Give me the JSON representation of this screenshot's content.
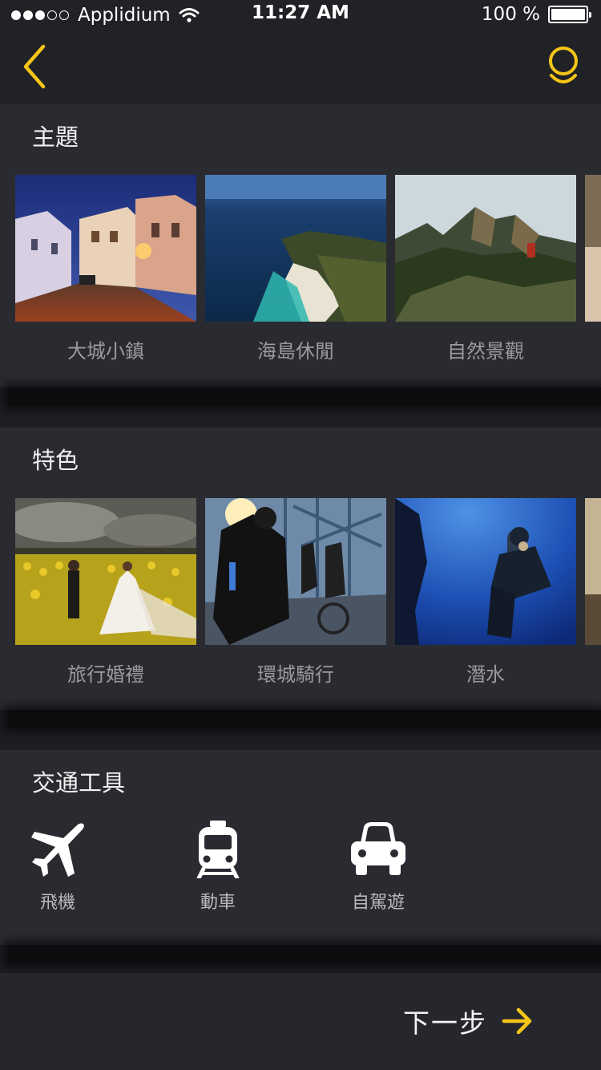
{
  "status_bar": {
    "carrier": "Applidium",
    "time": "11:27 AM",
    "battery": "100 %",
    "signal_dots_filled": 3,
    "signal_dots_total": 5
  },
  "nav": {
    "back_icon": "chevron-left-icon",
    "profile_icon": "profile-icon",
    "accent_color": "#f5c518"
  },
  "sections": {
    "theme": {
      "title": "主題",
      "items": [
        {
          "label": "大城小鎮",
          "image": "town-street-at-dusk"
        },
        {
          "label": "海島休閒",
          "image": "coastal-cliffs"
        },
        {
          "label": "自然景觀",
          "image": "mountain-peaks"
        }
      ]
    },
    "feature": {
      "title": "特色",
      "items": [
        {
          "label": "旅行婚禮",
          "image": "sunflower-wedding"
        },
        {
          "label": "環城騎行",
          "image": "cyclists-on-bridge"
        },
        {
          "label": "潛水",
          "image": "scuba-diver"
        }
      ]
    },
    "transport": {
      "title": "交通工具",
      "items": [
        {
          "label": "飛機",
          "icon": "airplane-icon"
        },
        {
          "label": "動車",
          "icon": "train-icon"
        },
        {
          "label": "自駕遊",
          "icon": "car-icon"
        }
      ]
    }
  },
  "footer": {
    "next_label": "下一步",
    "next_icon": "arrow-right-icon"
  }
}
